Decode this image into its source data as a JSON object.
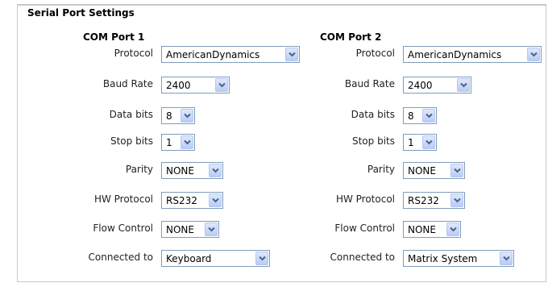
{
  "title": "Serial Port Settings",
  "field_labels": {
    "protocol": "Protocol",
    "baud_rate": "Baud Rate",
    "data_bits": "Data bits",
    "stop_bits": "Stop bits",
    "parity": "Parity",
    "hw_protocol": "HW Protocol",
    "flow_control": "Flow Control",
    "connected_to": "Connected to"
  },
  "ports": [
    {
      "name": "COM Port 1",
      "protocol": "AmericanDynamics",
      "baud_rate": "2400",
      "data_bits": "8",
      "stop_bits": "1",
      "parity": "NONE",
      "hw_protocol": "RS232",
      "flow_control": "NONE",
      "connected_to": "Keyboard"
    },
    {
      "name": "COM Port 2",
      "protocol": "AmericanDynamics",
      "baud_rate": "2400",
      "data_bits": "8",
      "stop_bits": "1",
      "parity": "NONE",
      "hw_protocol": "RS232",
      "flow_control": "NONE",
      "connected_to": "Matrix System"
    }
  ],
  "colors": {
    "dropdown_border": "#7f9db9",
    "dropdown_button": "#b9cbf6",
    "arrow": "#4d6185"
  }
}
